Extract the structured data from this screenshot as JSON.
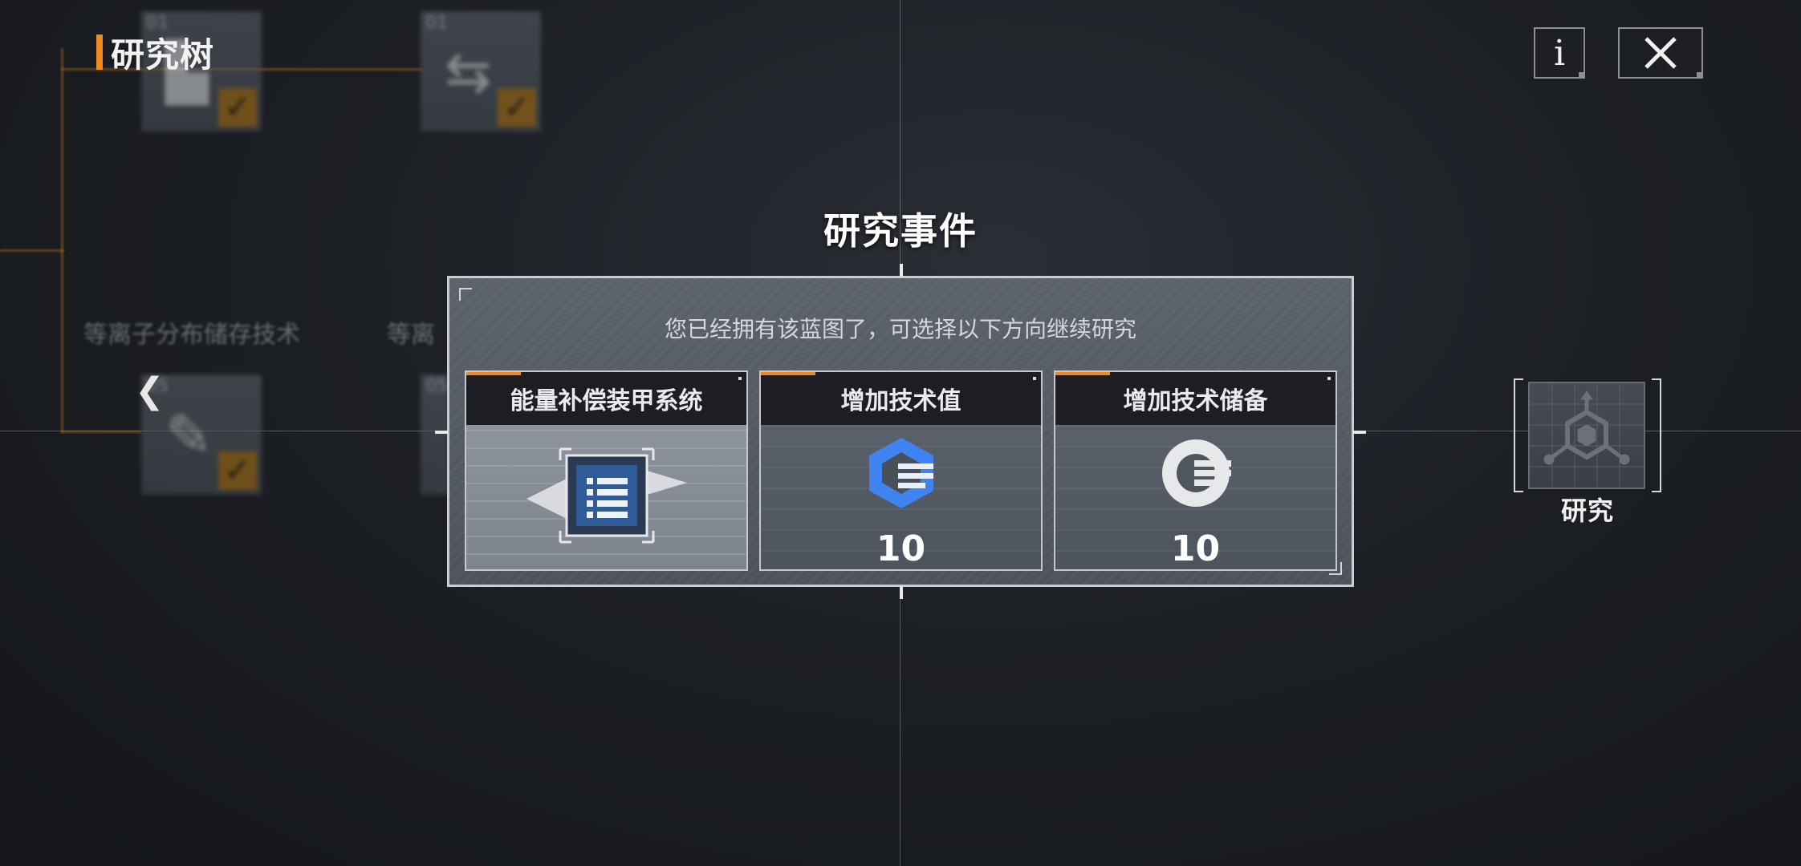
{
  "header": {
    "title": "研究树"
  },
  "buttons": {
    "info_label": "i",
    "back_glyph": "❮"
  },
  "background": {
    "node_numbers": [
      "01",
      "01",
      "05",
      "05"
    ],
    "labels": [
      "等离子分布储存技术",
      "等离"
    ]
  },
  "event": {
    "title": "研究事件",
    "subtitle": "您已经拥有该蓝图了，可选择以下方向继续研究",
    "options": [
      {
        "label": "能量补偿装甲系统",
        "value": "",
        "icon": "blueprint-list-icon"
      },
      {
        "label": "增加技术值",
        "value": "10",
        "icon": "tech-value-hex-icon"
      },
      {
        "label": "增加技术储备",
        "value": "10",
        "icon": "tech-reserve-ring-icon"
      }
    ]
  },
  "research_node": {
    "label": "研究",
    "icon": "research-molecule-icon"
  },
  "colors": {
    "accent": "#f08a1c",
    "panel_border": "#c8ccd2",
    "tech_blue": "#3f83f0"
  }
}
